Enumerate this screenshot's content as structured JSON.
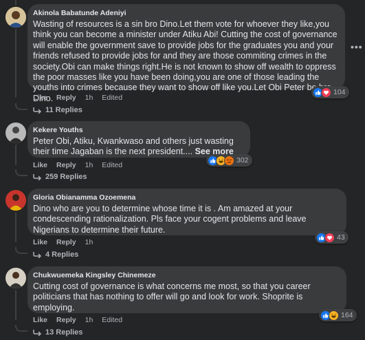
{
  "comments": [
    {
      "author": "Akinola Babatunde Adeniyi",
      "text": "Wasting of resources is a sin bro Dino.Let them vote for whoever they like,you think you can become a minister under Atiku Abi! Cutting the cost of governance will enable the government save to provide jobs for the graduates you and your friends refused to provide jobs for and they are those commiting crimes in the society.Obi can make things right.He is not known to show off wealth to oppress the poor masses like you have been doing,you are one of those leading the youths into crimes because they want to show off like you.Let Obi Peter be bro Dino.",
      "see_more": "",
      "actions": {
        "like": "Like",
        "reply": "Reply",
        "time": "1h",
        "edited": "Edited"
      },
      "reactions": [
        "like",
        "love"
      ],
      "reaction_count": "104",
      "replies": "11 Replies"
    },
    {
      "author": "Kekere Youths",
      "text": "Peter Obi, Atiku, Kwankwaso and others just wasting their time Jagaban is the next president....",
      "see_more": "See more",
      "actions": {
        "like": "Like",
        "reply": "Reply",
        "time": "1h",
        "edited": "Edited"
      },
      "reactions": [
        "like",
        "haha",
        "angry"
      ],
      "reaction_count": "302",
      "replies": "259 Replies"
    },
    {
      "author": "Gloria Obianamma Ozoemena",
      "text": "Dino who are you to determine whose time it is . Am amazed at your condescending rationalization. Pls face your cogent problems and leave Nigerians to determine their future.",
      "see_more": "",
      "actions": {
        "like": "Like",
        "reply": "Reply",
        "time": "1h",
        "edited": ""
      },
      "reactions": [
        "like",
        "love"
      ],
      "reaction_count": "43",
      "replies": "4 Replies"
    },
    {
      "author": "Chukwuemeka Kingsley Chinemeze",
      "text": "Cutting cost of governance is what concerns me most, so that you career politicians that has nothing to offer will go and look for work. Shoprite is employing.",
      "see_more": "",
      "actions": {
        "like": "Like",
        "reply": "Reply",
        "time": "1h",
        "edited": "Edited"
      },
      "reactions": [
        "like",
        "haha"
      ],
      "reaction_count": "164",
      "replies": "13 Replies"
    }
  ],
  "more_label": "•••",
  "colors": {
    "background": "#242526",
    "bubble": "#3a3b3c",
    "like": "#1877f2",
    "love": "#f33e58",
    "haha": "#f7b125",
    "angry": "#e9710f"
  }
}
